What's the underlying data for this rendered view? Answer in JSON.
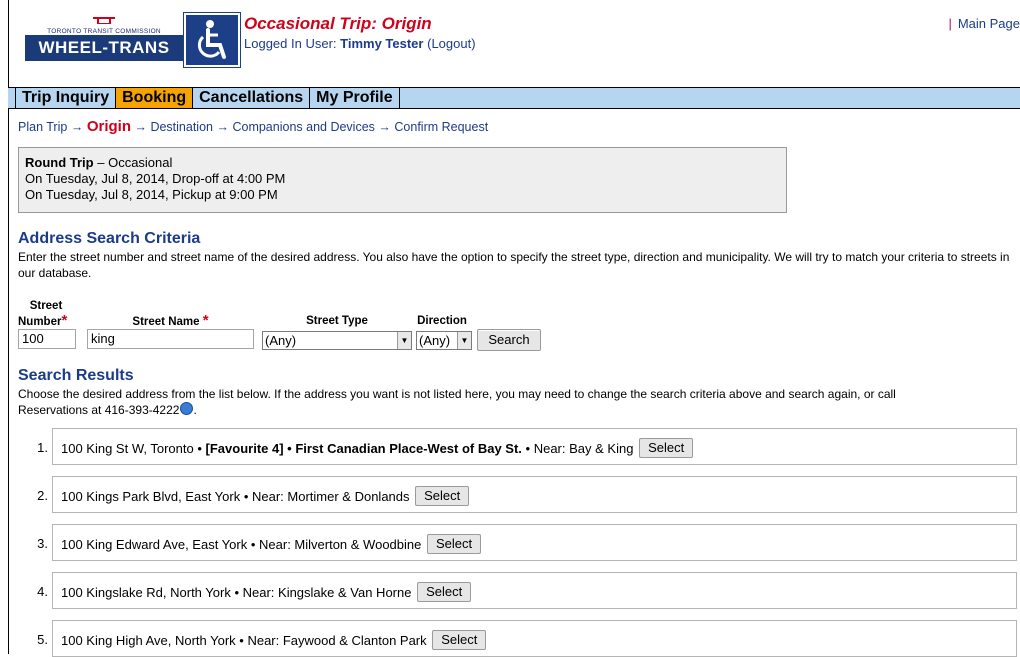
{
  "header": {
    "ttc_text": "TORONTO TRANSIT COMMISSION",
    "brand": "WHEEL-TRANS",
    "page_title": "Occasional Trip: Origin",
    "logged_in_label": "Logged In User:",
    "user_name": "Timmy Tester",
    "logout_label": "(Logout)",
    "main_page_label": "Main Page"
  },
  "nav": {
    "tabs": [
      {
        "label": "Trip Inquiry",
        "active": false
      },
      {
        "label": "Booking",
        "active": true
      },
      {
        "label": "Cancellations",
        "active": false
      },
      {
        "label": "My Profile",
        "active": false
      }
    ]
  },
  "breadcrumb": {
    "steps": [
      "Plan Trip",
      "Origin",
      "Destination",
      "Companions and Devices",
      "Confirm Request"
    ],
    "arrow": "→"
  },
  "trip": {
    "title": "Round Trip",
    "type": "– Occasional",
    "line1": "On Tuesday, Jul 8, 2014, Drop-off at 4:00 PM",
    "line2": "On Tuesday, Jul 8, 2014, Pickup at 9:00 PM"
  },
  "search": {
    "title": "Address Search Criteria",
    "description": "Enter the street number and street name of the desired address. You also have the option to specify the street type, direction and municipality. We will try to match your criteria to streets in our database.",
    "street_number_label_1": "Street",
    "street_number_label_2": "Number",
    "street_name_label": "Street Name",
    "street_type_label": "Street Type",
    "direction_label": "Direction",
    "street_number_value": "100",
    "street_name_value": "king",
    "street_type_value": "(Any)",
    "direction_value": "(Any)",
    "search_button": "Search"
  },
  "results": {
    "title": "Search Results",
    "description_1": "Choose the desired address from the list below. If the address you want is not listed here, you may need to change the search criteria above and search again, or call",
    "description_2": "Reservations at 416-393-4222",
    "description_end": ".",
    "select_label": "Select",
    "items": [
      {
        "num": "1.",
        "address": "100 King St W, Toronto •",
        "fav": "[Favourite 4] • First Canadian Place-West of Bay St.",
        "near": "• Near: Bay & King"
      },
      {
        "num": "2.",
        "address": "100 Kings Park Blvd, East York",
        "fav": "",
        "near": "• Near: Mortimer & Donlands"
      },
      {
        "num": "3.",
        "address": "100 King Edward Ave, East York",
        "fav": "",
        "near": "• Near: Milverton & Woodbine"
      },
      {
        "num": "4.",
        "address": "100 Kingslake Rd, North York",
        "fav": "",
        "near": "• Near: Kingslake & Van Horne"
      },
      {
        "num": "5.",
        "address": "100 King High Ave, North York",
        "fav": "",
        "near": "• Near: Faywood & Clanton Park"
      }
    ]
  },
  "colors": {
    "accent_red": "#d0021b",
    "link_blue": "#1c3c8a",
    "nav_bg": "#b6d5f0",
    "tab_active": "#f4a300",
    "brand_blue": "#1b3a7a"
  }
}
